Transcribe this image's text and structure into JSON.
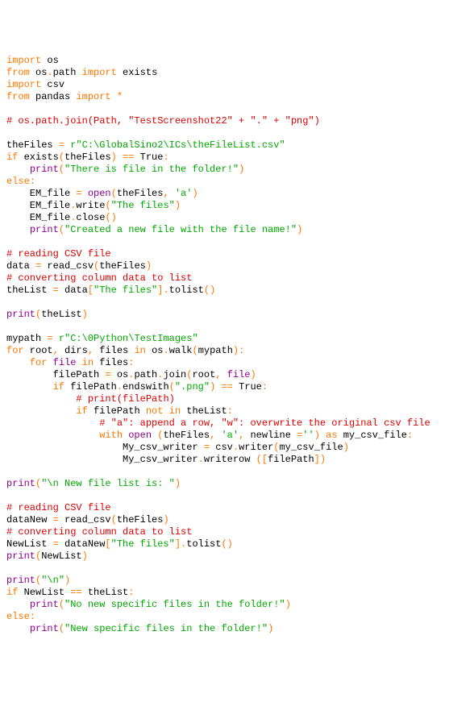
{
  "code": {
    "lines": [
      {
        "t": "import",
        "c": "kw"
      },
      {
        "t": " os",
        "c": "id"
      },
      {
        "t": "\n",
        "c": "nl"
      },
      {
        "t": "from",
        "c": "kw"
      },
      {
        "t": " os",
        "c": "id"
      },
      {
        "t": ".",
        "c": "kw"
      },
      {
        "t": "path ",
        "c": "id"
      },
      {
        "t": "import",
        "c": "kw"
      },
      {
        "t": " exists",
        "c": "id"
      },
      {
        "t": "\n",
        "c": "nl"
      },
      {
        "t": "import",
        "c": "kw"
      },
      {
        "t": " csv",
        "c": "id"
      },
      {
        "t": "\n",
        "c": "nl"
      },
      {
        "t": "from",
        "c": "kw"
      },
      {
        "t": " pandas ",
        "c": "id"
      },
      {
        "t": "import",
        "c": "kw"
      },
      {
        "t": " ",
        "c": "id"
      },
      {
        "t": "*",
        "c": "kw"
      },
      {
        "t": "\n",
        "c": "nl"
      },
      {
        "t": "\n",
        "c": "nl"
      },
      {
        "t": "# os.path.join(Path, \"TestScreenshot22\" + \".\" + \"png\")",
        "c": "cmt"
      },
      {
        "t": "\n",
        "c": "nl"
      },
      {
        "t": "\n",
        "c": "nl"
      },
      {
        "t": "theFiles ",
        "c": "id"
      },
      {
        "t": "=",
        "c": "kw"
      },
      {
        "t": " ",
        "c": "id"
      },
      {
        "t": "r\"C:\\GlobalSino2\\ICs\\theFileList.csv\"",
        "c": "str"
      },
      {
        "t": "\n",
        "c": "nl"
      },
      {
        "t": "if",
        "c": "kw"
      },
      {
        "t": " exists",
        "c": "id"
      },
      {
        "t": "(",
        "c": "kw"
      },
      {
        "t": "theFiles",
        "c": "id"
      },
      {
        "t": ")",
        "c": "kw"
      },
      {
        "t": " ",
        "c": "id"
      },
      {
        "t": "==",
        "c": "kw"
      },
      {
        "t": " True",
        "c": "id"
      },
      {
        "t": ":",
        "c": "kw"
      },
      {
        "t": "\n",
        "c": "nl"
      },
      {
        "t": "    ",
        "c": "id"
      },
      {
        "t": "print",
        "c": "bi"
      },
      {
        "t": "(",
        "c": "kw"
      },
      {
        "t": "\"There is file in the folder!\"",
        "c": "str"
      },
      {
        "t": ")",
        "c": "kw"
      },
      {
        "t": "\n",
        "c": "nl"
      },
      {
        "t": "else",
        "c": "kw"
      },
      {
        "t": ":",
        "c": "kw"
      },
      {
        "t": "\n",
        "c": "nl"
      },
      {
        "t": "    EM_file ",
        "c": "id"
      },
      {
        "t": "=",
        "c": "kw"
      },
      {
        "t": " ",
        "c": "id"
      },
      {
        "t": "open",
        "c": "bi"
      },
      {
        "t": "(",
        "c": "kw"
      },
      {
        "t": "theFiles",
        "c": "id"
      },
      {
        "t": ",",
        "c": "kw"
      },
      {
        "t": " ",
        "c": "id"
      },
      {
        "t": "'a'",
        "c": "str"
      },
      {
        "t": ")",
        "c": "kw"
      },
      {
        "t": "\n",
        "c": "nl"
      },
      {
        "t": "    EM_file",
        "c": "id"
      },
      {
        "t": ".",
        "c": "kw"
      },
      {
        "t": "write",
        "c": "id"
      },
      {
        "t": "(",
        "c": "kw"
      },
      {
        "t": "\"The files\"",
        "c": "str"
      },
      {
        "t": ")",
        "c": "kw"
      },
      {
        "t": "\n",
        "c": "nl"
      },
      {
        "t": "    EM_file",
        "c": "id"
      },
      {
        "t": ".",
        "c": "kw"
      },
      {
        "t": "close",
        "c": "id"
      },
      {
        "t": "()",
        "c": "kw"
      },
      {
        "t": "\n",
        "c": "nl"
      },
      {
        "t": "    ",
        "c": "id"
      },
      {
        "t": "print",
        "c": "bi"
      },
      {
        "t": "(",
        "c": "kw"
      },
      {
        "t": "\"Created a new file with the file name!\"",
        "c": "str"
      },
      {
        "t": ")",
        "c": "kw"
      },
      {
        "t": "\n",
        "c": "nl"
      },
      {
        "t": "\n",
        "c": "nl"
      },
      {
        "t": "# reading CSV file",
        "c": "cmt"
      },
      {
        "t": "\n",
        "c": "nl"
      },
      {
        "t": "data ",
        "c": "id"
      },
      {
        "t": "=",
        "c": "kw"
      },
      {
        "t": " read_csv",
        "c": "id"
      },
      {
        "t": "(",
        "c": "kw"
      },
      {
        "t": "theFiles",
        "c": "id"
      },
      {
        "t": ")",
        "c": "kw"
      },
      {
        "t": "\n",
        "c": "nl"
      },
      {
        "t": "# converting column data to list",
        "c": "cmt"
      },
      {
        "t": "\n",
        "c": "nl"
      },
      {
        "t": "theList ",
        "c": "id"
      },
      {
        "t": "=",
        "c": "kw"
      },
      {
        "t": " data",
        "c": "id"
      },
      {
        "t": "[",
        "c": "kw"
      },
      {
        "t": "\"The files\"",
        "c": "str"
      },
      {
        "t": "].",
        "c": "kw"
      },
      {
        "t": "tolist",
        "c": "id"
      },
      {
        "t": "()",
        "c": "kw"
      },
      {
        "t": "\n",
        "c": "nl"
      },
      {
        "t": "\n",
        "c": "nl"
      },
      {
        "t": "print",
        "c": "bi"
      },
      {
        "t": "(",
        "c": "kw"
      },
      {
        "t": "theList",
        "c": "id"
      },
      {
        "t": ")",
        "c": "kw"
      },
      {
        "t": "\n",
        "c": "nl"
      },
      {
        "t": "\n",
        "c": "nl"
      },
      {
        "t": "mypath ",
        "c": "id"
      },
      {
        "t": "=",
        "c": "kw"
      },
      {
        "t": " ",
        "c": "id"
      },
      {
        "t": "r\"C:\\0Python\\TestImages\"",
        "c": "str"
      },
      {
        "t": "\n",
        "c": "nl"
      },
      {
        "t": "for",
        "c": "kw"
      },
      {
        "t": " root",
        "c": "id"
      },
      {
        "t": ",",
        "c": "kw"
      },
      {
        "t": " dirs",
        "c": "id"
      },
      {
        "t": ",",
        "c": "kw"
      },
      {
        "t": " files ",
        "c": "id"
      },
      {
        "t": "in",
        "c": "kw"
      },
      {
        "t": " os",
        "c": "id"
      },
      {
        "t": ".",
        "c": "kw"
      },
      {
        "t": "walk",
        "c": "id"
      },
      {
        "t": "(",
        "c": "kw"
      },
      {
        "t": "mypath",
        "c": "id"
      },
      {
        "t": "):",
        "c": "kw"
      },
      {
        "t": "\n",
        "c": "nl"
      },
      {
        "t": "    ",
        "c": "id"
      },
      {
        "t": "for",
        "c": "kw"
      },
      {
        "t": " ",
        "c": "id"
      },
      {
        "t": "file",
        "c": "bi"
      },
      {
        "t": " ",
        "c": "id"
      },
      {
        "t": "in",
        "c": "kw"
      },
      {
        "t": " files",
        "c": "id"
      },
      {
        "t": ":",
        "c": "kw"
      },
      {
        "t": "\n",
        "c": "nl"
      },
      {
        "t": "        filePath ",
        "c": "id"
      },
      {
        "t": "=",
        "c": "kw"
      },
      {
        "t": " os",
        "c": "id"
      },
      {
        "t": ".",
        "c": "kw"
      },
      {
        "t": "path",
        "c": "id"
      },
      {
        "t": ".",
        "c": "kw"
      },
      {
        "t": "join",
        "c": "id"
      },
      {
        "t": "(",
        "c": "kw"
      },
      {
        "t": "root",
        "c": "id"
      },
      {
        "t": ",",
        "c": "kw"
      },
      {
        "t": " ",
        "c": "id"
      },
      {
        "t": "file",
        "c": "bi"
      },
      {
        "t": ")",
        "c": "kw"
      },
      {
        "t": "\n",
        "c": "nl"
      },
      {
        "t": "        ",
        "c": "id"
      },
      {
        "t": "if",
        "c": "kw"
      },
      {
        "t": " filePath",
        "c": "id"
      },
      {
        "t": ".",
        "c": "kw"
      },
      {
        "t": "endswith",
        "c": "id"
      },
      {
        "t": "(",
        "c": "kw"
      },
      {
        "t": "\".png\"",
        "c": "str"
      },
      {
        "t": ")",
        "c": "kw"
      },
      {
        "t": " ",
        "c": "id"
      },
      {
        "t": "==",
        "c": "kw"
      },
      {
        "t": " True",
        "c": "id"
      },
      {
        "t": ":",
        "c": "kw"
      },
      {
        "t": "\n",
        "c": "nl"
      },
      {
        "t": "            ",
        "c": "id"
      },
      {
        "t": "# print(filePath)",
        "c": "cmt"
      },
      {
        "t": "\n",
        "c": "nl"
      },
      {
        "t": "            ",
        "c": "id"
      },
      {
        "t": "if",
        "c": "kw"
      },
      {
        "t": " filePath ",
        "c": "id"
      },
      {
        "t": "not in",
        "c": "kw"
      },
      {
        "t": " theList",
        "c": "id"
      },
      {
        "t": ":",
        "c": "kw"
      },
      {
        "t": "\n",
        "c": "nl"
      },
      {
        "t": "                ",
        "c": "id"
      },
      {
        "t": "# \"a\": append a row, \"w\": overwrite the original csv file",
        "c": "cmt"
      },
      {
        "t": "\n",
        "c": "nl"
      },
      {
        "t": "                ",
        "c": "id"
      },
      {
        "t": "with",
        "c": "kw"
      },
      {
        "t": " ",
        "c": "id"
      },
      {
        "t": "open",
        "c": "bi"
      },
      {
        "t": " ",
        "c": "id"
      },
      {
        "t": "(",
        "c": "kw"
      },
      {
        "t": "theFiles",
        "c": "id"
      },
      {
        "t": ",",
        "c": "kw"
      },
      {
        "t": " ",
        "c": "id"
      },
      {
        "t": "'a'",
        "c": "str"
      },
      {
        "t": ",",
        "c": "kw"
      },
      {
        "t": " newline ",
        "c": "id"
      },
      {
        "t": "=",
        "c": "kw"
      },
      {
        "t": "''",
        "c": "str"
      },
      {
        "t": ")",
        "c": "kw"
      },
      {
        "t": " ",
        "c": "id"
      },
      {
        "t": "as",
        "c": "kw"
      },
      {
        "t": " my_csv_file",
        "c": "id"
      },
      {
        "t": ":",
        "c": "kw"
      },
      {
        "t": "\n",
        "c": "nl"
      },
      {
        "t": "                    My_csv_writer ",
        "c": "id"
      },
      {
        "t": "=",
        "c": "kw"
      },
      {
        "t": " csv",
        "c": "id"
      },
      {
        "t": ".",
        "c": "kw"
      },
      {
        "t": "writer",
        "c": "id"
      },
      {
        "t": "(",
        "c": "kw"
      },
      {
        "t": "my_csv_file",
        "c": "id"
      },
      {
        "t": ")",
        "c": "kw"
      },
      {
        "t": "\n",
        "c": "nl"
      },
      {
        "t": "                    My_csv_writer",
        "c": "id"
      },
      {
        "t": ".",
        "c": "kw"
      },
      {
        "t": "writerow ",
        "c": "id"
      },
      {
        "t": "([",
        "c": "kw"
      },
      {
        "t": "filePath",
        "c": "id"
      },
      {
        "t": "])",
        "c": "kw"
      },
      {
        "t": "\n",
        "c": "nl"
      },
      {
        "t": "\n",
        "c": "nl"
      },
      {
        "t": "print",
        "c": "bi"
      },
      {
        "t": "(",
        "c": "kw"
      },
      {
        "t": "\"\\n New file list is: \"",
        "c": "str"
      },
      {
        "t": ")",
        "c": "kw"
      },
      {
        "t": "\n",
        "c": "nl"
      },
      {
        "t": "\n",
        "c": "nl"
      },
      {
        "t": "# reading CSV file",
        "c": "cmt"
      },
      {
        "t": "\n",
        "c": "nl"
      },
      {
        "t": "dataNew ",
        "c": "id"
      },
      {
        "t": "=",
        "c": "kw"
      },
      {
        "t": " read_csv",
        "c": "id"
      },
      {
        "t": "(",
        "c": "kw"
      },
      {
        "t": "theFiles",
        "c": "id"
      },
      {
        "t": ")",
        "c": "kw"
      },
      {
        "t": "\n",
        "c": "nl"
      },
      {
        "t": "# converting column data to list",
        "c": "cmt"
      },
      {
        "t": "\n",
        "c": "nl"
      },
      {
        "t": "NewList ",
        "c": "id"
      },
      {
        "t": "=",
        "c": "kw"
      },
      {
        "t": " dataNew",
        "c": "id"
      },
      {
        "t": "[",
        "c": "kw"
      },
      {
        "t": "\"The files\"",
        "c": "str"
      },
      {
        "t": "].",
        "c": "kw"
      },
      {
        "t": "tolist",
        "c": "id"
      },
      {
        "t": "()",
        "c": "kw"
      },
      {
        "t": "\n",
        "c": "nl"
      },
      {
        "t": "print",
        "c": "bi"
      },
      {
        "t": "(",
        "c": "kw"
      },
      {
        "t": "NewList",
        "c": "id"
      },
      {
        "t": ")",
        "c": "kw"
      },
      {
        "t": "\n",
        "c": "nl"
      },
      {
        "t": "\n",
        "c": "nl"
      },
      {
        "t": "print",
        "c": "bi"
      },
      {
        "t": "(",
        "c": "kw"
      },
      {
        "t": "\"\\n\"",
        "c": "str"
      },
      {
        "t": ")",
        "c": "kw"
      },
      {
        "t": "\n",
        "c": "nl"
      },
      {
        "t": "if",
        "c": "kw"
      },
      {
        "t": " NewList ",
        "c": "id"
      },
      {
        "t": "==",
        "c": "kw"
      },
      {
        "t": " theList",
        "c": "id"
      },
      {
        "t": ":",
        "c": "kw"
      },
      {
        "t": "\n",
        "c": "nl"
      },
      {
        "t": "    ",
        "c": "id"
      },
      {
        "t": "print",
        "c": "bi"
      },
      {
        "t": "(",
        "c": "kw"
      },
      {
        "t": "\"No new specific files in the folder!\"",
        "c": "str"
      },
      {
        "t": ")",
        "c": "kw"
      },
      {
        "t": "\n",
        "c": "nl"
      },
      {
        "t": "else",
        "c": "kw"
      },
      {
        "t": ":",
        "c": "kw"
      },
      {
        "t": "\n",
        "c": "nl"
      },
      {
        "t": "    ",
        "c": "id"
      },
      {
        "t": "print",
        "c": "bi"
      },
      {
        "t": "(",
        "c": "kw"
      },
      {
        "t": "\"New specific files in the folder!\"",
        "c": "str"
      },
      {
        "t": ")",
        "c": "kw"
      },
      {
        "t": "\n",
        "c": "nl"
      }
    ]
  }
}
